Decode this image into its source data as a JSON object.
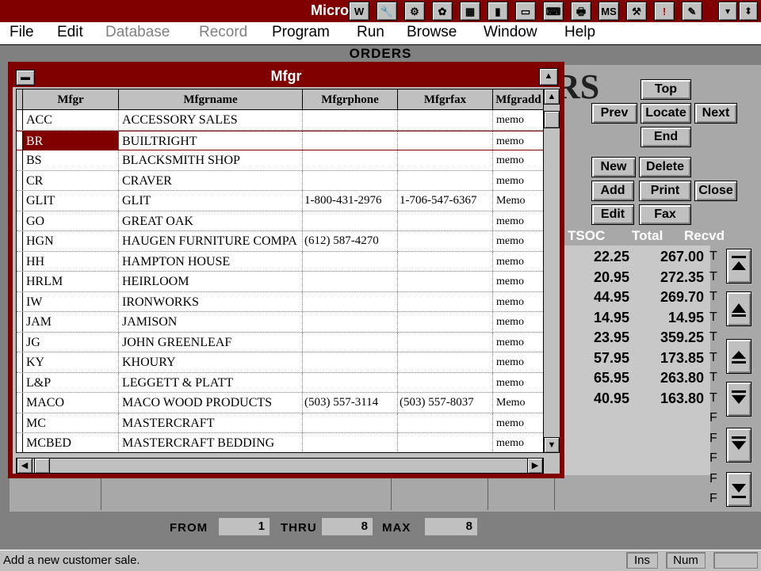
{
  "app": {
    "title": "Micro",
    "toolbar_icons": [
      "w-icon",
      "wrench-icon",
      "chart-icon",
      "butterfly-icon",
      "grid-icon",
      "file-icon",
      "monitor-icon",
      "keyboard-icon",
      "printer-icon",
      "ms-icon",
      "tools-icon",
      "exclamation-icon",
      "edit-icon"
    ],
    "minimize_label": "▾",
    "restore_label": "⬍"
  },
  "menu": [
    {
      "label": "File",
      "enabled": true
    },
    {
      "label": "Edit",
      "enabled": true
    },
    {
      "label": "Database",
      "enabled": false
    },
    {
      "label": "Record",
      "enabled": false
    },
    {
      "label": "Program",
      "enabled": true
    },
    {
      "label": "Run",
      "enabled": true
    },
    {
      "label": "Browse",
      "enabled": true
    },
    {
      "label": "Window",
      "enabled": true
    },
    {
      "label": "Help",
      "enabled": true
    }
  ],
  "orders": {
    "title": "ORDERS",
    "logo_fragment": "RS",
    "buttons": {
      "top": "Top",
      "prev": "Prev",
      "locate": "Locate",
      "next": "Next",
      "end": "End",
      "new": "New",
      "delete": "Delete",
      "add": "Add",
      "print": "Print",
      "close": "Close",
      "edit": "Edit",
      "fax": "Fax"
    },
    "columns": {
      "tsoc": "TSOC",
      "total": "Total",
      "recvd": "Recvd"
    },
    "rows": [
      {
        "tsoc": "22.25",
        "total": "267.00",
        "flag": "T"
      },
      {
        "tsoc": "20.95",
        "total": "272.35",
        "flag": "T"
      },
      {
        "tsoc": "44.95",
        "total": "269.70",
        "flag": "T"
      },
      {
        "tsoc": "14.95",
        "total": "14.95",
        "flag": "T"
      },
      {
        "tsoc": "23.95",
        "total": "359.25",
        "flag": "T"
      },
      {
        "tsoc": "57.95",
        "total": "173.85",
        "flag": "T"
      },
      {
        "tsoc": "65.95",
        "total": "263.80",
        "flag": "T"
      },
      {
        "tsoc": "40.95",
        "total": "163.80",
        "flag": "T"
      },
      {
        "tsoc": "",
        "total": "",
        "flag": "F"
      },
      {
        "tsoc": "",
        "total": "",
        "flag": "F"
      },
      {
        "tsoc": "",
        "total": "",
        "flag": "F"
      },
      {
        "tsoc": "",
        "total": "",
        "flag": "F"
      },
      {
        "tsoc": "",
        "total": "",
        "flag": "F"
      }
    ],
    "footer": {
      "from_label": "FROM",
      "from_value": "1",
      "thru_label": "THRU",
      "thru_value": "8",
      "max_label": "MAX",
      "max_value": "8"
    }
  },
  "mfgr": {
    "title": "Mfgr",
    "headers": [
      "Mfgr",
      "Mfgrname",
      "Mfgrphone",
      "Mfgrfax",
      "Mfgradd"
    ],
    "selected_index": 1,
    "rows": [
      [
        "ACC",
        "ACCESSORY SALES",
        "",
        "",
        "memo"
      ],
      [
        "BR",
        "BUILTRIGHT",
        "",
        "",
        "memo"
      ],
      [
        "BS",
        "BLACKSMITH SHOP",
        "",
        "",
        "memo"
      ],
      [
        "CR",
        "CRAVER",
        "",
        "",
        "memo"
      ],
      [
        "GLIT",
        "GLIT",
        "1-800-431-2976",
        "1-706-547-6367",
        "Memo"
      ],
      [
        "GO",
        "GREAT OAK",
        "",
        "",
        "memo"
      ],
      [
        "HGN",
        "HAUGEN FURNITURE COMPA",
        "(612) 587-4270",
        "",
        "memo"
      ],
      [
        "HH",
        "HAMPTON HOUSE",
        "",
        "",
        "memo"
      ],
      [
        "HRLM",
        "HEIRLOOM",
        "",
        "",
        "memo"
      ],
      [
        "IW",
        "IRONWORKS",
        "",
        "",
        "memo"
      ],
      [
        "JAM",
        "JAMISON",
        "",
        "",
        "memo"
      ],
      [
        "JG",
        "JOHN GREENLEAF",
        "",
        "",
        "memo"
      ],
      [
        "KY",
        "KHOURY",
        "",
        "",
        "memo"
      ],
      [
        "L&P",
        "LEGGETT & PLATT",
        "",
        "",
        "memo"
      ],
      [
        "MACO",
        "MACO WOOD PRODUCTS",
        "(503) 557-3114",
        "(503) 557-8037",
        "Memo"
      ],
      [
        "MC",
        "MASTERCRAFT",
        "",
        "",
        "memo"
      ],
      [
        "MCBED",
        "MASTERCRAFT BEDDING",
        "",
        "",
        "memo"
      ]
    ]
  },
  "status": {
    "message": "Add a new customer sale.",
    "ins": "Ins",
    "num": "Num"
  }
}
